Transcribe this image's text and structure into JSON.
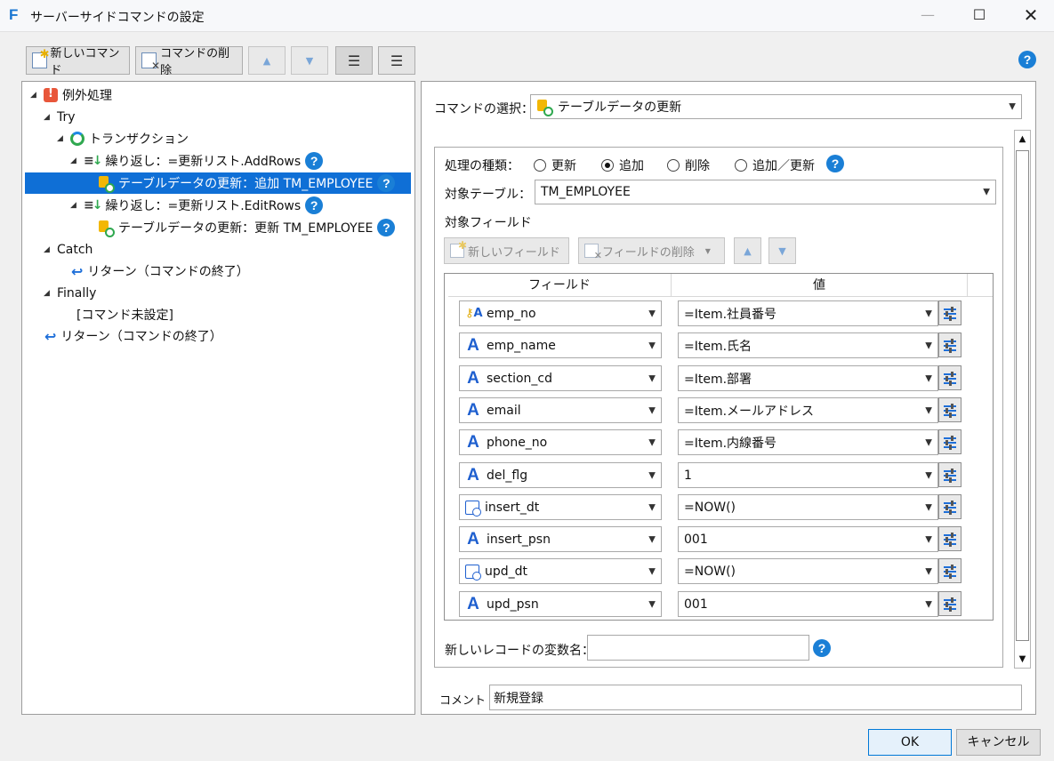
{
  "window": {
    "title": "サーバーサイドコマンドの設定",
    "logo": "F"
  },
  "toolbar": {
    "new_command": "新しいコマンド",
    "delete_command": "コマンドの削除"
  },
  "tree": {
    "items": [
      {
        "label": "例外処理"
      },
      {
        "label": "Try"
      },
      {
        "label": "トランザクション"
      },
      {
        "label": "繰り返し：=更新リスト.AddRows"
      },
      {
        "label": "テーブルデータの更新：追加 TM_EMPLOYEE"
      },
      {
        "label": "繰り返し：=更新リスト.EditRows"
      },
      {
        "label": "テーブルデータの更新：更新 TM_EMPLOYEE"
      },
      {
        "label": "Catch"
      },
      {
        "label": "リターン（コマンドの終了）"
      },
      {
        "label": "Finally"
      },
      {
        "label": "[コマンド未設定]"
      },
      {
        "label": "リターン（コマンドの終了）"
      }
    ]
  },
  "command_select": {
    "label": "コマンドの選択：",
    "value": "テーブルデータの更新"
  },
  "process": {
    "label": "処理の種類：",
    "options": [
      "更新",
      "追加",
      "削除",
      "追加／更新"
    ],
    "selected": "追加"
  },
  "target_table": {
    "label": "対象テーブル：",
    "value": "TM_EMPLOYEE"
  },
  "target_fields": {
    "label": "対象フィールド",
    "new_field": "新しいフィールド",
    "delete_field": "フィールドの削除",
    "headers": [
      "フィールド",
      "値"
    ],
    "rows": [
      {
        "field": "emp_no",
        "value": "=Item.社員番号",
        "icon": "key-text-icon"
      },
      {
        "field": "emp_name",
        "value": "=Item.氏名",
        "icon": "text-icon"
      },
      {
        "field": "section_cd",
        "value": "=Item.部署",
        "icon": "text-icon"
      },
      {
        "field": "email",
        "value": "=Item.メールアドレス",
        "icon": "text-icon"
      },
      {
        "field": "phone_no",
        "value": "=Item.内線番号",
        "icon": "text-icon"
      },
      {
        "field": "del_flg",
        "value": "1",
        "icon": "text-icon"
      },
      {
        "field": "insert_dt",
        "value": "=NOW()",
        "icon": "datetime-icon"
      },
      {
        "field": "insert_psn",
        "value": "001",
        "icon": "text-icon"
      },
      {
        "field": "upd_dt",
        "value": "=NOW()",
        "icon": "datetime-icon"
      },
      {
        "field": "upd_psn",
        "value": "001",
        "icon": "text-icon"
      }
    ]
  },
  "new_record_var": {
    "label": "新しいレコードの変数名：",
    "value": ""
  },
  "comment": {
    "label": "コメント",
    "value": "新規登録"
  },
  "buttons": {
    "ok": "OK",
    "cancel": "キャンセル"
  }
}
